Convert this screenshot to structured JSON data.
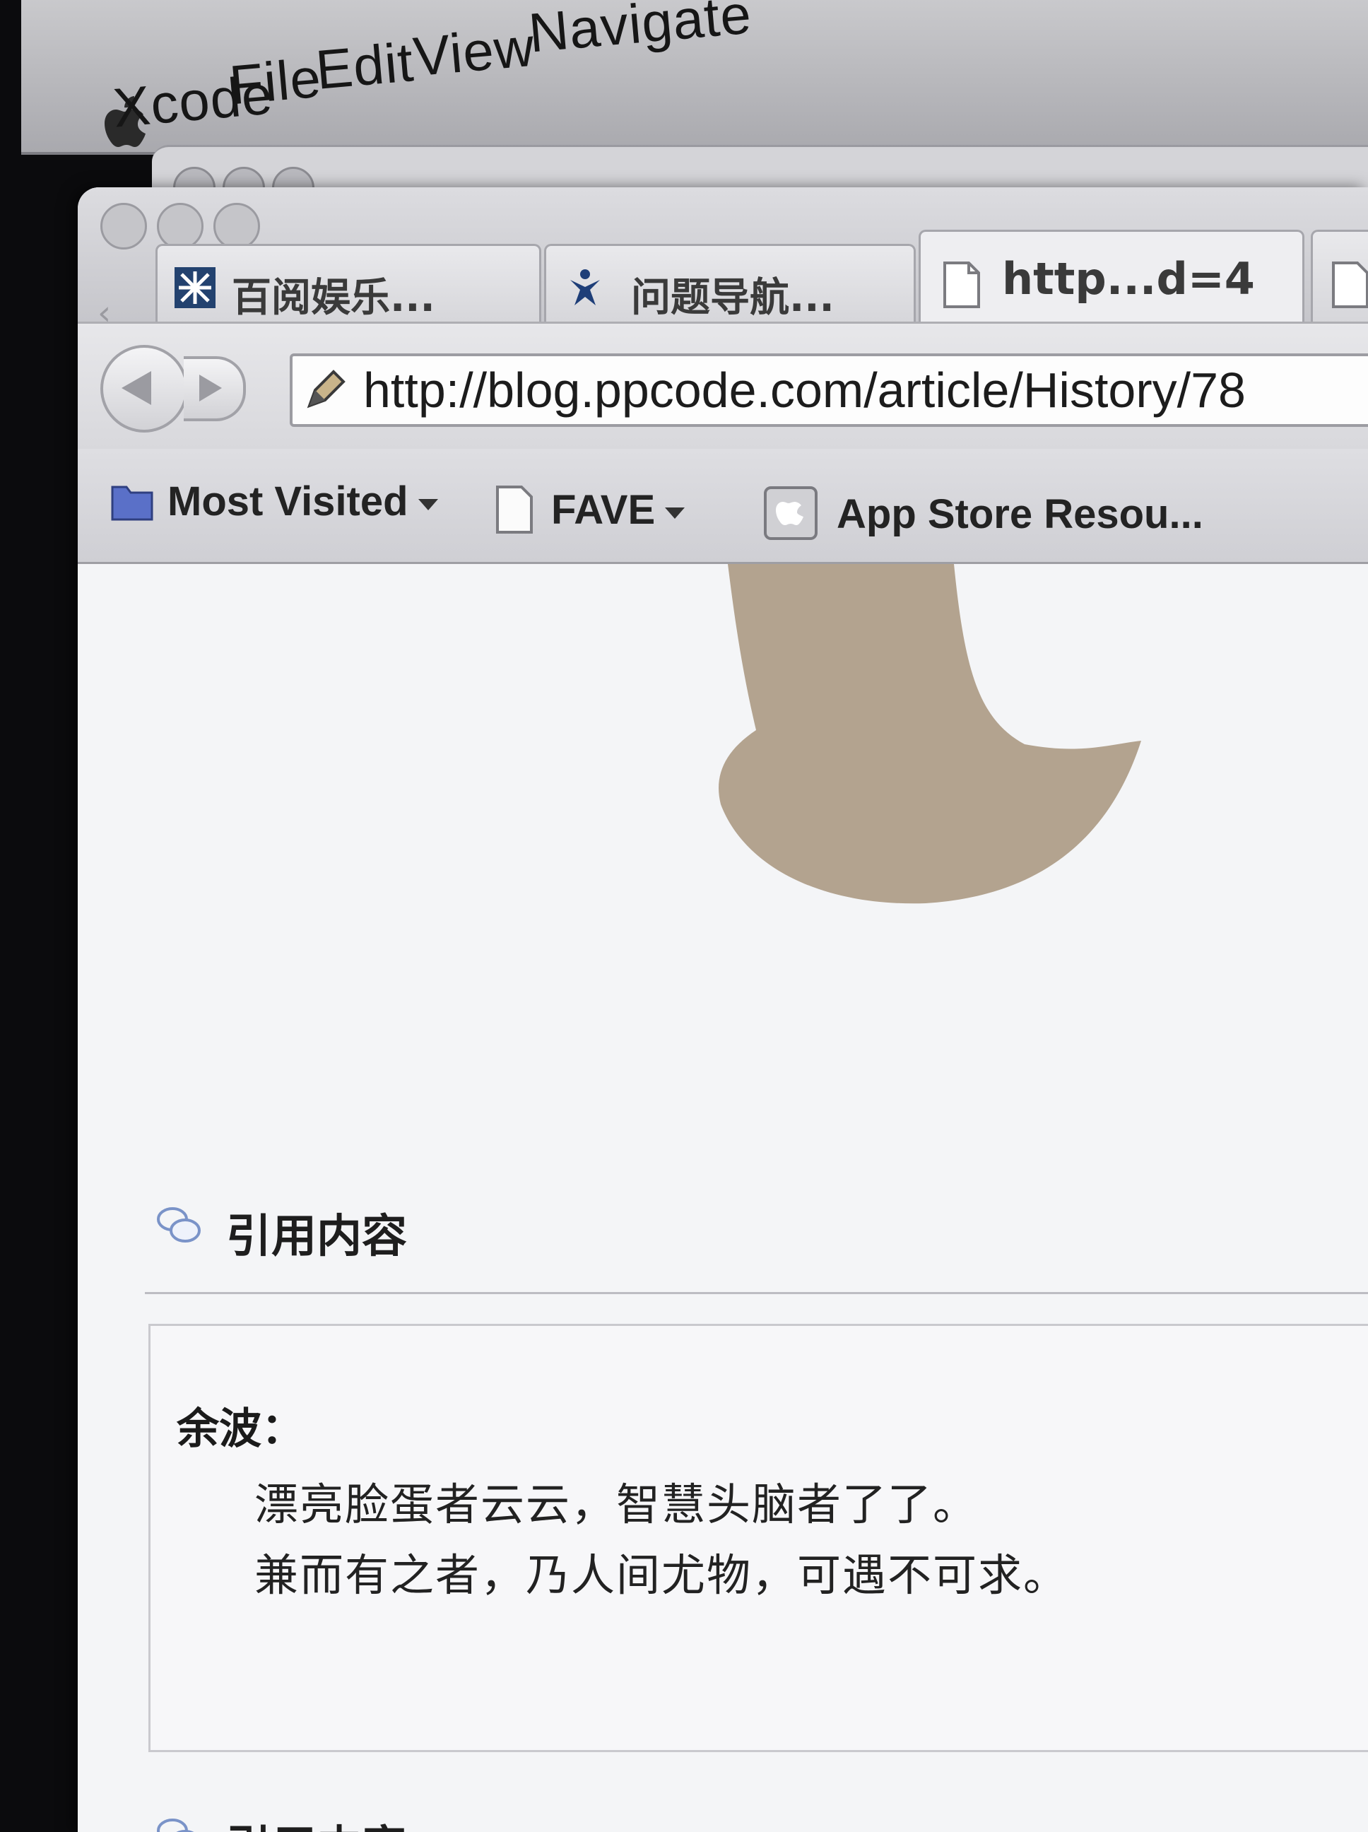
{
  "menubar": {
    "items": [
      "Xcode",
      "File",
      "Edit",
      "View",
      "Navigate"
    ]
  },
  "tabs": [
    {
      "label": "百阅娱乐...",
      "icon": "site-logo-icon"
    },
    {
      "label": "问题导航...",
      "icon": "person-logo-icon"
    },
    {
      "label": "http...d=4",
      "icon": "page-icon"
    }
  ],
  "toolbar": {
    "url": "http://blog.ppcode.com/article/History/78"
  },
  "bookmarks": [
    {
      "label": "Most Visited",
      "icon": "folder-icon",
      "has_dropdown": true
    },
    {
      "label": "FAVE",
      "icon": "page-icon",
      "has_dropdown": true
    },
    {
      "label": "App Store Resou...",
      "icon": "app-icon",
      "has_dropdown": false
    }
  ],
  "content": {
    "quote1": {
      "header": "引用内容",
      "author": "余波：",
      "lines": [
        "漂亮脸蛋者云云，智慧头脑者了了。",
        "兼而有之者，乃人间尤物，可遇不可求。"
      ]
    },
    "quote2": {
      "header": "引用内容"
    }
  },
  "colors": {
    "avatar_tan": "#b3a38f",
    "menubar_bg": "#b8b8bd",
    "page_bg": "#f4f5f7"
  }
}
